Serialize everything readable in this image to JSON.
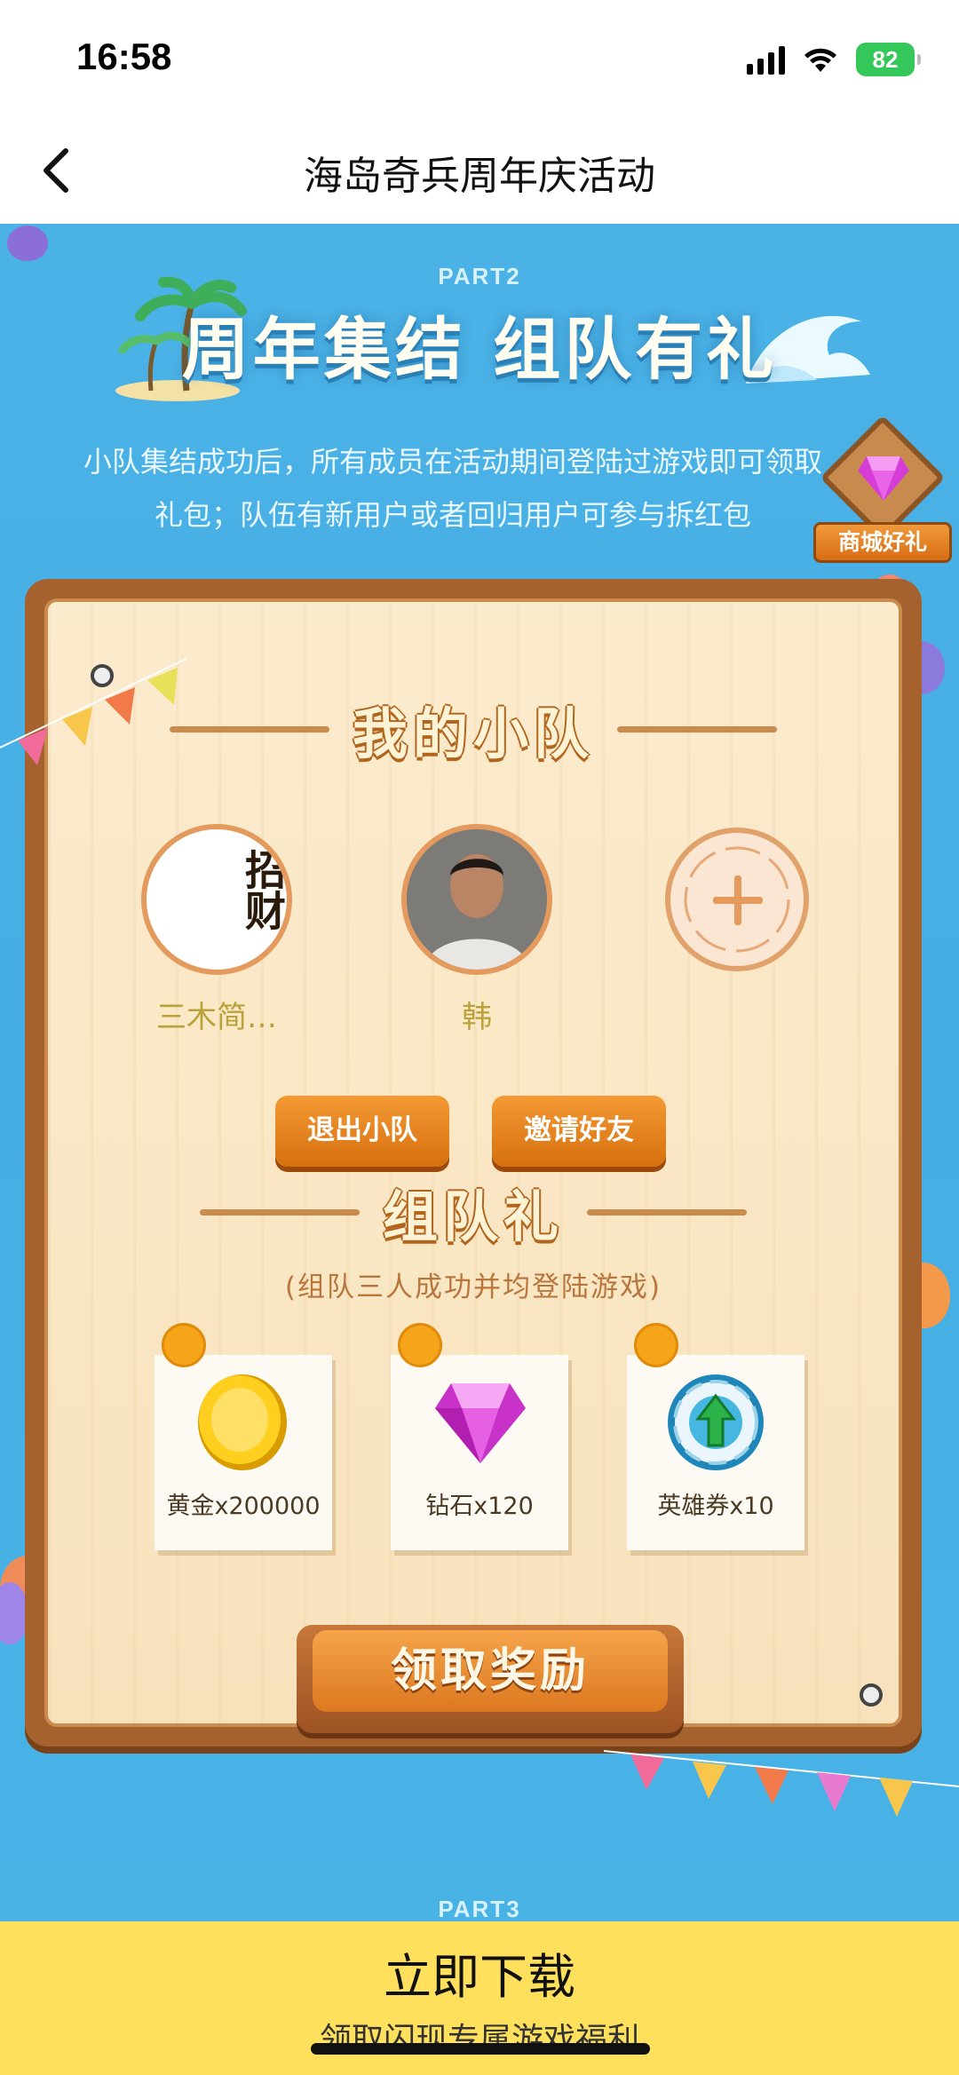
{
  "status_bar": {
    "time": "16:58",
    "battery": "82"
  },
  "nav": {
    "title": "海岛奇兵周年庆活动",
    "back_icon": "chevron-left-icon"
  },
  "event": {
    "part2_label": "PART2",
    "headline": "周年集结 组队有礼",
    "description_line1": "小队集结成功后，所有成员在活动期间登陆过游戏即可领取",
    "description_line2": "礼包；队伍有新用户或者回归用户可参与拆红包",
    "shop_badge": {
      "label": "商城好礼",
      "icon": "diamond-icon"
    },
    "part3_label": "PART3"
  },
  "team": {
    "title": "我的小队",
    "members": [
      {
        "name": "三木简…",
        "avatar_text": "招财"
      },
      {
        "name": "韩"
      }
    ],
    "add_member_icon": "plus-icon",
    "buttons": {
      "leave": "退出小队",
      "invite": "邀请好友"
    }
  },
  "team_gift": {
    "title": "组队礼",
    "subtitle": "(组队三人成功并均登陆游戏)",
    "rewards": [
      {
        "icon": "gold-coin-icon",
        "label": "黄金x200000"
      },
      {
        "icon": "diamond-icon",
        "label": "钻石x120"
      },
      {
        "icon": "hero-ticket-icon",
        "label": "英雄券x10"
      }
    ],
    "claim_button": "领取奖励"
  },
  "download": {
    "title": "立即下载",
    "subtitle": "领取闪现专属游戏福利"
  },
  "colors": {
    "sky": "#4bb2e6",
    "board_wood": "#a5622f",
    "button_orange": "#e2801d",
    "download_bar": "#ffe05c"
  }
}
